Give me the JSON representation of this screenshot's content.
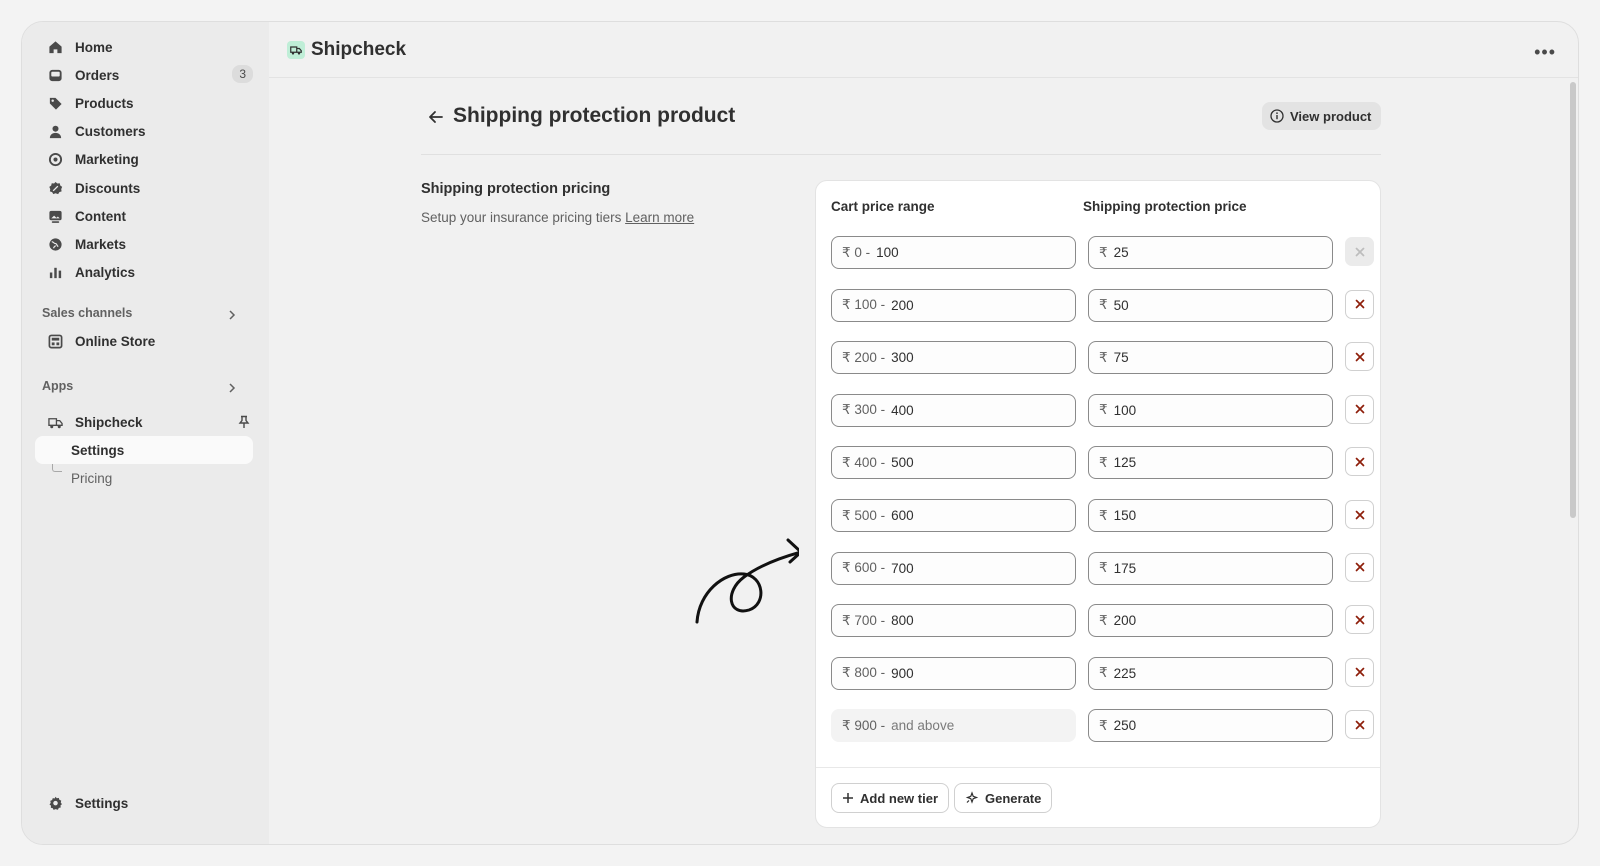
{
  "sidebar": {
    "nav": [
      {
        "label": "Home",
        "icon": "home-icon"
      },
      {
        "label": "Orders",
        "icon": "inbox-icon",
        "badge": "3"
      },
      {
        "label": "Products",
        "icon": "tag-icon"
      },
      {
        "label": "Customers",
        "icon": "person-icon"
      },
      {
        "label": "Marketing",
        "icon": "target-icon"
      },
      {
        "label": "Discounts",
        "icon": "discount-icon"
      },
      {
        "label": "Content",
        "icon": "image-icon"
      },
      {
        "label": "Markets",
        "icon": "globe-icon"
      },
      {
        "label": "Analytics",
        "icon": "bar-chart-icon"
      }
    ],
    "sales_channels_label": "Sales channels",
    "online_store_label": "Online Store",
    "apps_label": "Apps",
    "app_name": "Shipcheck",
    "app_sub": [
      "Settings",
      "Pricing"
    ],
    "settings_label": "Settings"
  },
  "topbar": {
    "app_title": "Shipcheck",
    "more_label": "•••"
  },
  "page": {
    "title": "Shipping protection product",
    "view_button": "View product",
    "section_title": "Shipping protection pricing",
    "section_desc": "Setup your insurance pricing tiers",
    "learn_more": "Learn more"
  },
  "table": {
    "col_range": "Cart price range",
    "col_price": "Shipping protection price",
    "currency": "₹",
    "rows": [
      {
        "from": "0 -",
        "to": "100",
        "price": "25"
      },
      {
        "from": "100 -",
        "to": "200",
        "price": "50"
      },
      {
        "from": "200 -",
        "to": "300",
        "price": "75"
      },
      {
        "from": "300 -",
        "to": "400",
        "price": "100"
      },
      {
        "from": "400 -",
        "to": "500",
        "price": "125"
      },
      {
        "from": "500 -",
        "to": "600",
        "price": "150"
      },
      {
        "from": "600 -",
        "to": "700",
        "price": "175"
      },
      {
        "from": "700 -",
        "to": "800",
        "price": "200"
      },
      {
        "from": "800 -",
        "to": "900",
        "price": "225"
      },
      {
        "from": "900 -",
        "to": "and above",
        "price": "250"
      }
    ],
    "add_tier": "Add new tier",
    "generate": "Generate"
  },
  "colors": {
    "accent_red": "#8e1f0b",
    "app_logo_bg": "#bfeed7"
  }
}
